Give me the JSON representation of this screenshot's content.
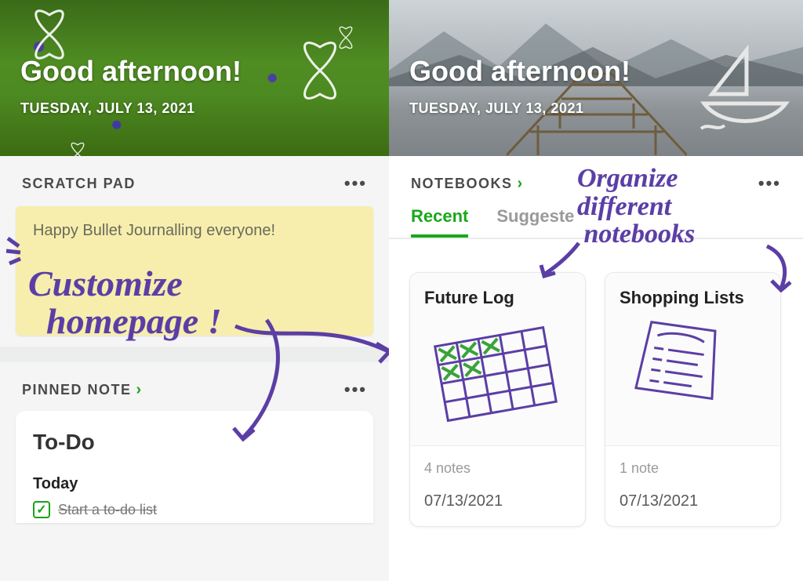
{
  "left": {
    "hero": {
      "greeting": "Good afternoon!",
      "date": "TUESDAY, JULY 13, 2021"
    },
    "scratch": {
      "title": "SCRATCH PAD",
      "text": "Happy Bullet Journalling everyone!"
    },
    "pinned": {
      "title": "PINNED NOTE",
      "note_title": "To-Do",
      "section": "Today",
      "item": "Start a to-do list",
      "checked": true
    },
    "annotation": {
      "line1": "Customize",
      "line2": "homepage !"
    }
  },
  "right": {
    "hero": {
      "greeting": "Good afternoon!",
      "date": "TUESDAY, JULY 13, 2021"
    },
    "notebooks": {
      "title": "NOTEBOOKS",
      "tabs": {
        "recent": "Recent",
        "suggested": "Suggeste"
      },
      "cards": [
        {
          "title": "Future Log",
          "count": "4 notes",
          "date": "07/13/2021"
        },
        {
          "title": "Shopping Lists",
          "count": "1 note",
          "date": "07/13/2021"
        }
      ]
    },
    "annotation": {
      "line1": "Organize",
      "line2": "different",
      "line3": "notebooks"
    }
  }
}
